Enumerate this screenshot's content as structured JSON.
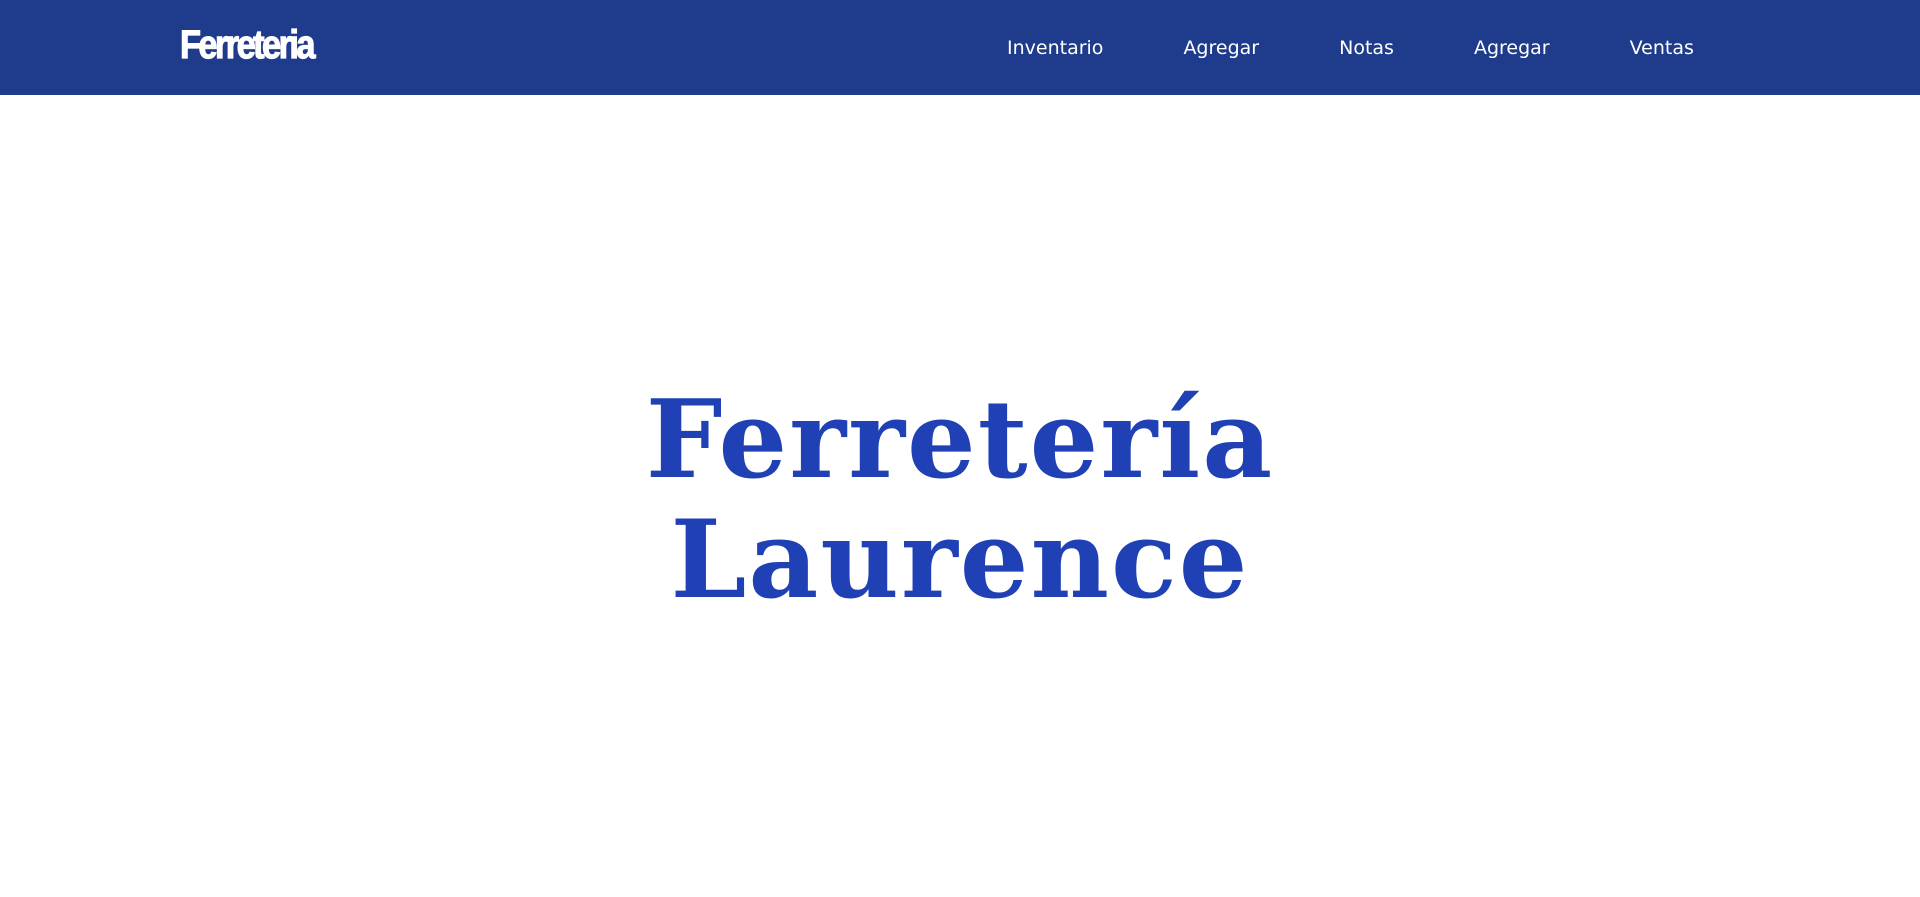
{
  "header": {
    "brand": "Ferreteria",
    "nav": [
      {
        "label": "Inventario"
      },
      {
        "label": "Agregar"
      },
      {
        "label": "Notas"
      },
      {
        "label": "Agregar"
      },
      {
        "label": "Ventas"
      }
    ]
  },
  "hero": {
    "line1": "Ferretería",
    "line2": "Laurence"
  },
  "colors": {
    "navbar_bg": "#1f3b8c",
    "nav_text": "#ffffff",
    "hero_text": "#2041b5",
    "page_bg": "#ffffff"
  }
}
